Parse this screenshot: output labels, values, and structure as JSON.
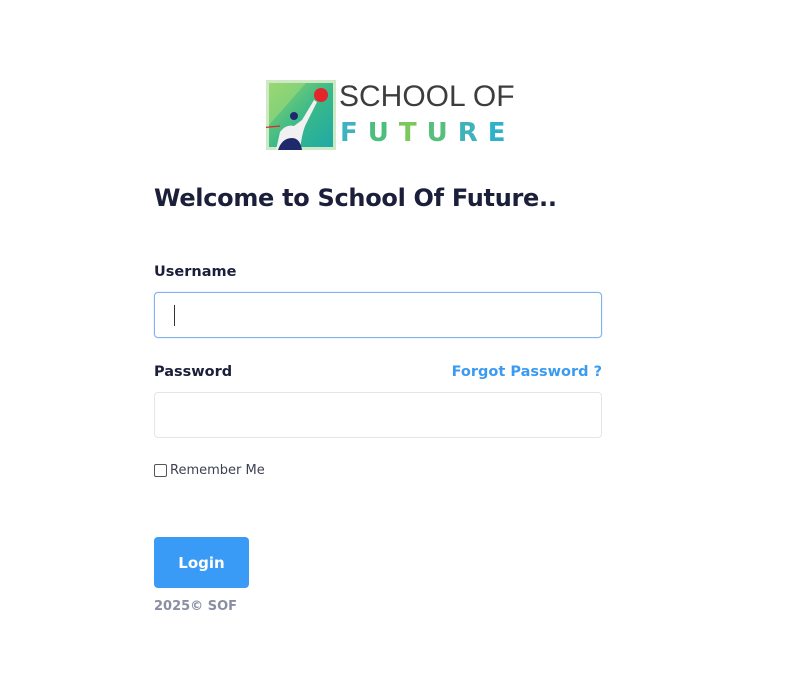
{
  "logo": {
    "line1": "SCHOOL OF",
    "line2_letters": [
      "F",
      "U",
      "T",
      "U",
      "R",
      "E"
    ],
    "line2_colors": [
      "#3fb2c2",
      "#4cbe7e",
      "#7bc95a",
      "#55bf7c",
      "#3fb3b9",
      "#2fb2c9"
    ]
  },
  "welcome_title": "Welcome to School Of Future..",
  "form": {
    "username_label": "Username",
    "username_value": "",
    "password_label": "Password",
    "password_value": "",
    "forgot_password": "Forgot Password ?",
    "remember_label": "Remember Me",
    "remember_checked": false,
    "login_label": "Login"
  },
  "footer": "2025© SOF",
  "colors": {
    "accent": "#3a9bf7",
    "title": "#1b1f3a",
    "muted": "#8a8ea3"
  }
}
